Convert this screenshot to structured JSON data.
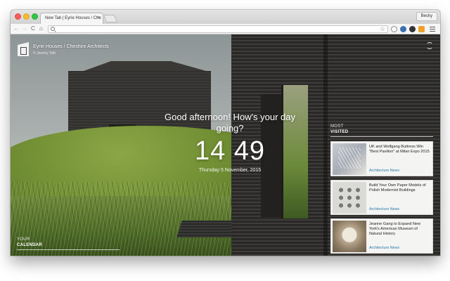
{
  "browser": {
    "tab_title": "New Tab | Eyrie Houses / Che",
    "tab_close": "×",
    "profile": "Becky",
    "back_glyph": "←",
    "forward_glyph": "→",
    "reload_glyph": "C",
    "home_glyph": "⌂",
    "star_glyph": "☆"
  },
  "photo": {
    "title": "Eyrie Houses / Cheshire Architects",
    "credit": "© Jeremy Toth"
  },
  "greeting": "Good afternoon! How's your day going?",
  "clock": "14 49",
  "date": "Thursday 5 November, 2015",
  "most_visited": {
    "heading_top": "MOST",
    "heading_bottom": "VISITED",
    "items": [
      {
        "title": "UK and Wolfgang Buttress Win \"Best Pavilion\" at Milan Expo 2015",
        "source": "Architecture News"
      },
      {
        "title": "Build Your Own Paper Models of Polish Modernist Buildings",
        "source": "Architecture News"
      },
      {
        "title": "Jeanne Gang to Expand New York's American Museum of Natural History",
        "source": "Architecture News"
      }
    ]
  },
  "calendar": {
    "heading_top": "YOUR",
    "heading_bottom": "CALENDAR"
  }
}
